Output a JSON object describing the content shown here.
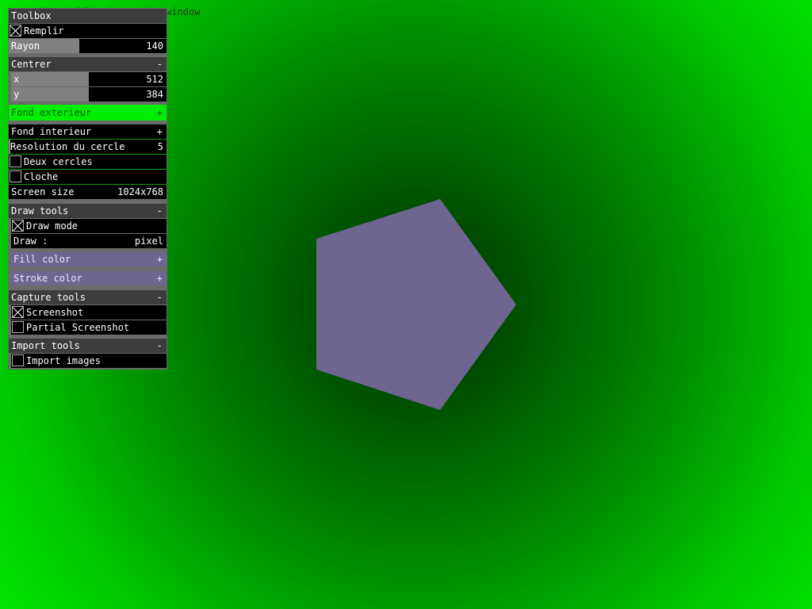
{
  "hint": "Drop image files into this window",
  "toolbox": {
    "title": "Toolbox",
    "refresh_icon": "↻",
    "save_icon": "💾",
    "remplir_label": "Remplir",
    "remplir_checked": true,
    "rayon_label": "Rayon",
    "rayon_value": "140",
    "centrer_label": "Centrer",
    "centrer_toggle": "-",
    "x_label": "x",
    "x_value": "512",
    "y_label": "y",
    "y_value": "384",
    "fond_exterieur_label": "Fond exterieur",
    "fond_exterieur_toggle": "+",
    "fond_interieur_label": "Fond interieur",
    "fond_interieur_toggle": "+",
    "resolution_label": "Resolution du cercle",
    "resolution_value": "5",
    "deux_cercles_label": "Deux cercles",
    "cloche_label": "Cloche",
    "screen_size_label": "Screen size",
    "screen_size_value": "1024x768",
    "draw_tools_label": "Draw tools",
    "draw_tools_toggle": "-",
    "draw_mode_label": "Draw mode",
    "draw_label": "Draw :",
    "draw_value": "pixel",
    "fill_color_label": "Fill color",
    "fill_color_toggle": "+",
    "stroke_color_label": "Stroke color",
    "stroke_color_toggle": "+",
    "capture_tools_label": "Capture tools",
    "capture_tools_toggle": "-",
    "screenshot_label": "Screenshot",
    "partial_screenshot_label": "Partial Screenshot",
    "import_tools_label": "Import tools",
    "import_tools_toggle": "-",
    "import_images_label": "Import images"
  },
  "colors": {
    "fill": "#6e6590",
    "background_outer": "#00f000",
    "background_inner": "#002a00"
  }
}
